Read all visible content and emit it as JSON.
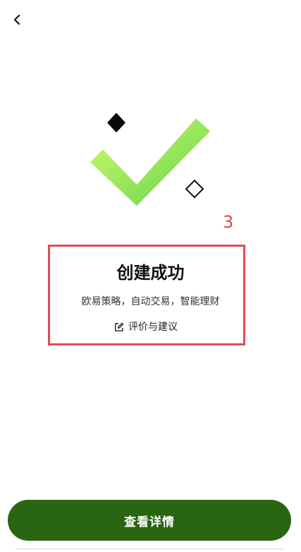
{
  "header": {
    "back_icon": "chevron-left-icon"
  },
  "hero": {
    "check_icon": "checkmark-icon",
    "decor_filled": "diamond-filled-icon",
    "decor_outline": "diamond-outline-icon",
    "colors": {
      "check_light": "#c8f765",
      "check_dark": "#5fd34a"
    }
  },
  "annotation": {
    "step_number": "3",
    "color": "#e24a53"
  },
  "result": {
    "title": "创建成功",
    "subtitle": "欧易策略，自动交易，智能理财",
    "feedback_icon": "edit-icon",
    "feedback_label": "评价与建议"
  },
  "footer": {
    "primary_label": "查看详情",
    "primary_color": "#2a6512"
  }
}
